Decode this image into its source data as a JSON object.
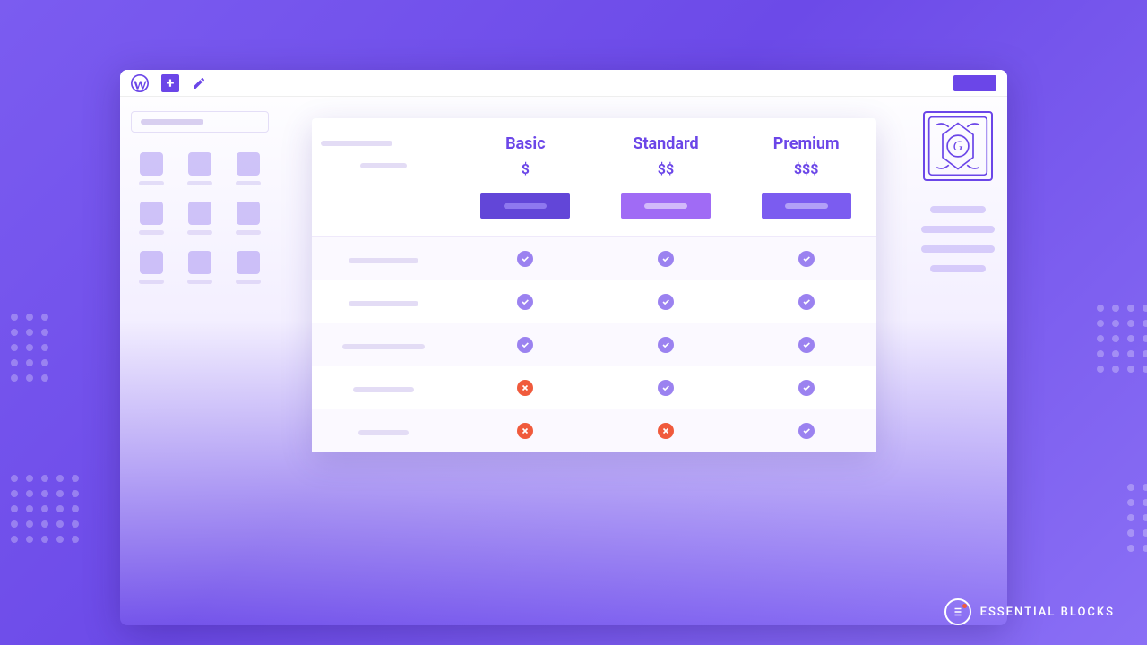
{
  "colors": {
    "primary": "#6b46e8",
    "accent": "#f05a3c"
  },
  "toolbar": {
    "update_label": ""
  },
  "sidebar_left": {
    "search_placeholder": ""
  },
  "sidebar_right": {
    "logo_letter": "G"
  },
  "pricing": {
    "plans": [
      {
        "name": "Basic",
        "price_symbol": "$"
      },
      {
        "name": "Standard",
        "price_symbol": "$$"
      },
      {
        "name": "Premium",
        "price_symbol": "$$$"
      }
    ],
    "features": [
      {
        "basic": true,
        "standard": true,
        "premium": true
      },
      {
        "basic": true,
        "standard": true,
        "premium": true
      },
      {
        "basic": true,
        "standard": true,
        "premium": true
      },
      {
        "basic": false,
        "standard": true,
        "premium": true
      },
      {
        "basic": false,
        "standard": false,
        "premium": true
      }
    ]
  },
  "brand": {
    "name": "ESSENTIAL BLOCKS"
  }
}
